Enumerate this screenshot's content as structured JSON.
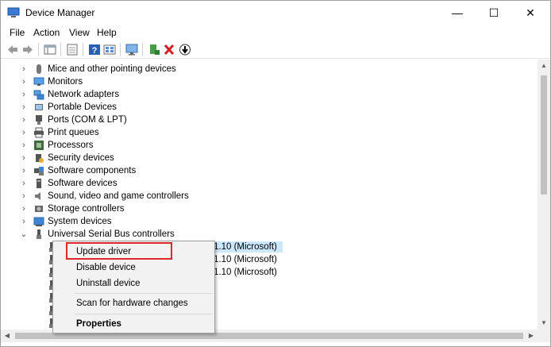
{
  "window": {
    "title": "Device Manager",
    "app_icon": "device-manager-icon"
  },
  "window_controls": {
    "minimize": "—",
    "maximize": "☐",
    "close": "✕"
  },
  "menu": [
    "File",
    "Action",
    "View",
    "Help"
  ],
  "toolbar": {
    "buttons": [
      "back-icon",
      "forward-icon",
      "properties-grid-icon",
      "document-icon",
      "help-icon",
      "view-icon",
      "monitor-icon",
      "add-driver-icon",
      "uninstall-icon",
      "download-icon"
    ]
  },
  "tree": {
    "items": [
      {
        "label": "Mice and other pointing devices",
        "icon": "mouse-icon"
      },
      {
        "label": "Monitors",
        "icon": "monitor-icon"
      },
      {
        "label": "Network adapters",
        "icon": "network-icon"
      },
      {
        "label": "Portable Devices",
        "icon": "portable-device-icon"
      },
      {
        "label": "Ports (COM & LPT)",
        "icon": "port-icon"
      },
      {
        "label": "Print queues",
        "icon": "printer-icon"
      },
      {
        "label": "Processors",
        "icon": "processor-icon"
      },
      {
        "label": "Security devices",
        "icon": "security-icon"
      },
      {
        "label": "Software components",
        "icon": "software-component-icon"
      },
      {
        "label": "Software devices",
        "icon": "software-device-icon"
      },
      {
        "label": "Sound, video and game controllers",
        "icon": "speaker-icon"
      },
      {
        "label": "Storage controllers",
        "icon": "storage-icon"
      },
      {
        "label": "System devices",
        "icon": "system-icon"
      },
      {
        "label": "Universal Serial Bus controllers",
        "icon": "usb-icon"
      }
    ],
    "usb_children": [
      {
        "label": "1.10 (Microsoft)"
      },
      {
        "label": "1.10 (Microsoft)"
      },
      {
        "label": "1.10 (Microsoft)"
      }
    ]
  },
  "context_menu": {
    "items": [
      "Update driver",
      "Disable device",
      "Uninstall device",
      "Scan for hardware changes",
      "Properties"
    ]
  },
  "colors": {
    "highlight": "#cce8ff",
    "annotation_box": "#e02828"
  }
}
